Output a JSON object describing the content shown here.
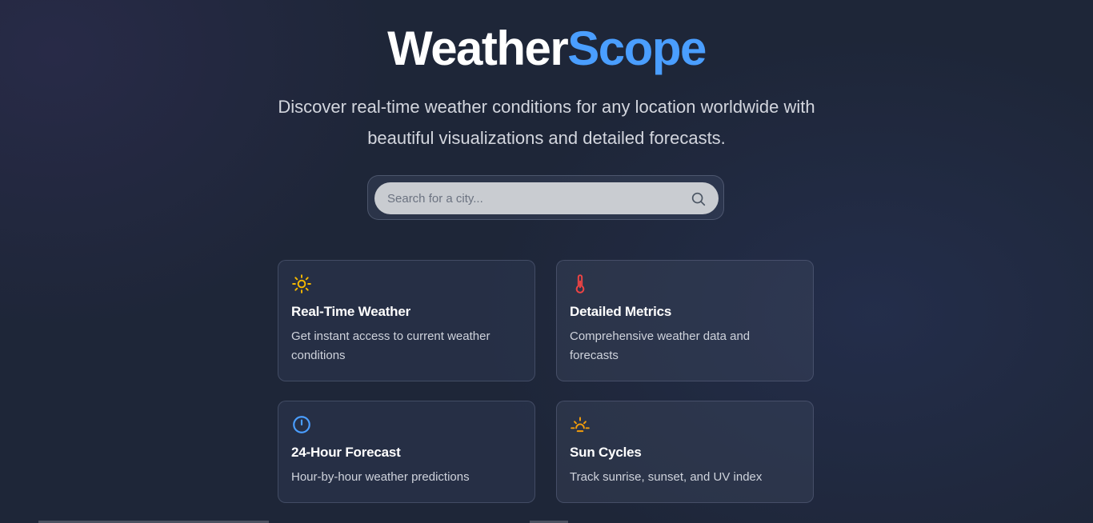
{
  "header": {
    "title_part1": "Weather",
    "title_part2": "Scope",
    "subtitle": "Discover real-time weather conditions for any location worldwide with beautiful visualizations and detailed forecasts."
  },
  "search": {
    "placeholder": "Search for a city...",
    "value": "",
    "icon": "search-icon"
  },
  "features": [
    {
      "icon": "sun-icon",
      "icon_color": "#f5b800",
      "title": "Real-Time Weather",
      "description": "Get instant access to current weather conditions"
    },
    {
      "icon": "thermometer-icon",
      "icon_color": "#ef4444",
      "title": "Detailed Metrics",
      "description": "Comprehensive weather data and forecasts"
    },
    {
      "icon": "clock-icon",
      "icon_color": "#4a9eff",
      "title": "24-Hour Forecast",
      "description": "Hour-by-hour weather predictions"
    },
    {
      "icon": "sunrise-icon",
      "icon_color": "#f59e0b",
      "title": "Sun Cycles",
      "description": "Track sunrise, sunset, and UV index"
    }
  ],
  "colors": {
    "accent": "#4a9eff",
    "background": "#1e2638"
  }
}
